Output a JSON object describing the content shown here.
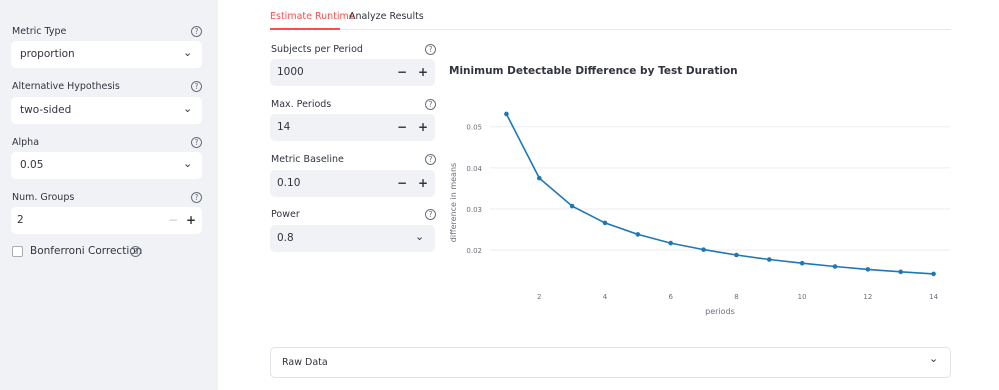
{
  "sidebar": {
    "metric_type": {
      "label": "Metric Type",
      "value": "proportion"
    },
    "alternative": {
      "label": "Alternative Hypothesis",
      "value": "two-sided"
    },
    "alpha": {
      "label": "Alpha",
      "value": "0.05"
    },
    "num_groups": {
      "label": "Num. Groups",
      "value": "2"
    },
    "bonferroni": {
      "label": "Bonferroni Correction",
      "checked": false
    },
    "help": "?"
  },
  "tabs": [
    {
      "label": "Estimate Runtime",
      "active": true
    },
    {
      "label": "Analyze Results",
      "active": false
    }
  ],
  "inputs": {
    "subjects": {
      "label": "Subjects per Period",
      "value": "1000"
    },
    "max_periods": {
      "label": "Max. Periods",
      "value": "14"
    },
    "baseline": {
      "label": "Metric Baseline",
      "value": "0.10"
    },
    "power": {
      "label": "Power",
      "value": "0.8"
    }
  },
  "controls": {
    "minus": "−",
    "plus": "+",
    "chevron": "⌄"
  },
  "expander": {
    "label": "Raw Data"
  },
  "chart_data": {
    "type": "line",
    "title": "Minimum Detectable Difference by Test Duration",
    "xlabel": "periods",
    "ylabel": "difference in means",
    "x": [
      1,
      2,
      3,
      4,
      5,
      6,
      7,
      8,
      9,
      10,
      11,
      12,
      13,
      14
    ],
    "values": [
      0.0531,
      0.0375,
      0.0307,
      0.0266,
      0.0238,
      0.0217,
      0.0201,
      0.0188,
      0.0177,
      0.0168,
      0.016,
      0.0153,
      0.0147,
      0.0142
    ],
    "xticks": [
      2,
      4,
      6,
      8,
      10,
      12,
      14
    ],
    "yticks": [
      0.02,
      0.03,
      0.04,
      0.05
    ],
    "ytick_labels": [
      "0.02",
      "0.03",
      "0.04",
      "0.05"
    ],
    "xlim": [
      0.5,
      14.5
    ],
    "ylim": [
      0.0115,
      0.0565
    ],
    "line_color": "#1f77b4",
    "grid": true
  }
}
